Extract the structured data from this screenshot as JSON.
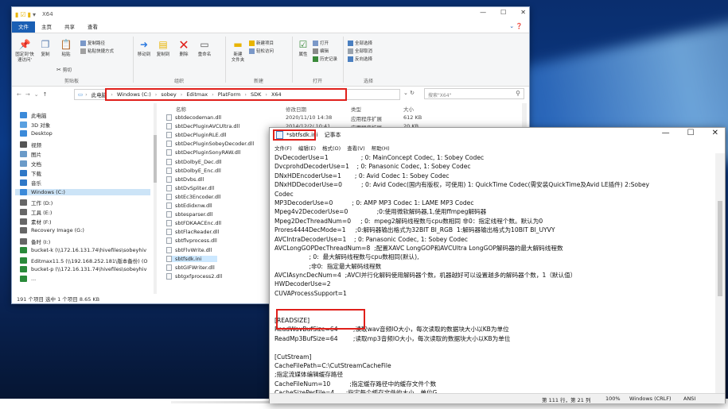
{
  "explorer": {
    "title": "X64",
    "tabs": [
      "文件",
      "主页",
      "共享",
      "查看"
    ],
    "ribbon": {
      "clipboard": {
        "pin": "固定到'快\n速访问'",
        "copy": "复制",
        "paste": "粘贴",
        "cut_path": "复制路径",
        "paste_shortcut": "粘贴快捷方式",
        "cut": "剪切",
        "label": "剪贴板"
      },
      "organize": {
        "move_to": "移动到",
        "copy_to": "复制到",
        "delete": "删除",
        "rename": "重命名",
        "label": "组织"
      },
      "new": {
        "new_folder": "新建\n文件夹",
        "new_item": "新建项目",
        "easy_access": "轻松访问",
        "label": "新建"
      },
      "open": {
        "properties": "属性",
        "open": "打开",
        "edit": "编辑",
        "history": "历史记录",
        "label": "打开"
      },
      "select": {
        "select_all": "全部选择",
        "select_none": "全部取消",
        "invert": "反向选择",
        "label": "选择"
      }
    },
    "address": {
      "segments": [
        "此电脑",
        "Windows (C:)",
        "sobey",
        "Editmax",
        "PlatForm",
        "SDK",
        "X64"
      ]
    },
    "search_placeholder": "搜索\"X64\"",
    "nav_items": [
      {
        "label": "此电脑",
        "color": "#3b8ad9"
      },
      {
        "label": "3D 对象",
        "color": "#5aa0e0"
      },
      {
        "label": "Desktop",
        "color": "#3b8ad9"
      },
      {
        "label": "视频",
        "color": "#555"
      },
      {
        "label": "图片",
        "color": "#6a9ac8"
      },
      {
        "label": "文档",
        "color": "#6a9ac8"
      },
      {
        "label": "下载",
        "color": "#2f78c7"
      },
      {
        "label": "音乐",
        "color": "#2f78c7"
      },
      {
        "label": "Windows (C:)",
        "color": "#3b8ad9"
      },
      {
        "label": "工作 (D:)",
        "color": "#666"
      },
      {
        "label": "工具 (E:)",
        "color": "#666"
      },
      {
        "label": "素材 (F:)",
        "color": "#666"
      },
      {
        "label": "Recovery Image (G:)",
        "color": "#666"
      },
      {
        "label": "备时 (I:)",
        "color": "#666"
      },
      {
        "label": "bucket-k (\\\\172.16.131.74\\hivefiles\\sobeyhiv",
        "color": "#2a8a3a"
      },
      {
        "label": "Editmax11.5 (\\\\192.168.252.181\\版本备份) (O",
        "color": "#2a8a3a"
      },
      {
        "label": "bucket-p (\\\\172.16.131.74\\hivefiles\\sobeyhiv",
        "color": "#2a8a3a"
      },
      {
        "label": "...",
        "color": "#2a8a3a"
      }
    ],
    "columns": [
      "名称",
      "修改日期",
      "类型",
      "大小"
    ],
    "files": [
      "sbtdecodeman.dll",
      "sbtDecPluginAVCUltra.dll",
      "sbtDecPluginRLE.dll",
      "sbtDecPluginSobeyDecoder.dll",
      "sbtDecPluginSonyRAW.dll",
      "sbtDolbyE_Dec.dll",
      "sbtDolbyE_Enc.dll",
      "sbtDvbs.dll",
      "sbtDvSpliter.dll",
      "sbtEc3Encoder.dll",
      "sbtEdidxnw.dll",
      "sbtesparser.dll",
      "sbtFDKAACEnc.dll",
      "sbtFlacReader.dll",
      "sbtflvprocess.dll",
      "sbtFlvWrite.dll",
      "sbtfsdk.ini",
      "sbtGIFWriter.dll",
      "sbtgxfprocess2.dll"
    ],
    "selected_file_index": 16,
    "first_row": {
      "date": "2020/11/10 14:38",
      "type": "应用程序扩展",
      "size": "612 KB"
    },
    "second_row": {
      "date": "2014/12/2/ 10:41",
      "type": "应用程序扩展",
      "size": "20 KB"
    },
    "status": "191 个项目    选中 1 个项目  8.65 KB"
  },
  "notepad": {
    "filename": "*sbtfsdk.ini",
    "app": "记事本",
    "menu": [
      "文件(F)",
      "编辑(E)",
      "格式(O)",
      "查看(V)",
      "帮助(H)"
    ],
    "lines": [
      "DvDecoderUse=1                 ; 0: MainConcept Codec, 1: Sobey Codec",
      "DvcprohdDecoderUse=1    ; 0: Panasonic Codec, 1: Sobey Codec",
      "DNxHDEncoderUse=1       ; 0: Avid Codec 1: Sobey Codec",
      "DNxHDDecoderUse=0          ; 0: Avid Codec(国内有版权，可使用) 1: QuickTime Codec(需安装QuickTime及Avid LE插件) 2:Sobey",
      "Codec",
      "MP3DecoderUse=0          ; 0: AMP MP3 Codec 1: LAME MP3 Codec",
      "Mpeg4v2DecoderUse=0               ;0:使用微软解码器,1,使用ffmpeg解码器",
      "Mpeg2DecThreadNum=0     ; 0:  mpeg2解码线程数与cpu数相同 非0：指定线程个数。默认为0",
      "Prores4444DecMode=1     ;0:解码器输出格式为32BIT BI_RGB  1:解码器输出格式为10BIT BI_UYVY",
      "AVCIntraDecoderUse=1    ; 0: Panasonic Codec, 1: Sobey Codec",
      "AVCLongGOPDecThreadNum=8  ;配置XAVC LongGOP和AVCUltra LongGOP解码器的最大解码线程数",
      "                  ; 0:  最大解码线程数与cpu数相同(默认),",
      "                  ;非0:  指定最大解码线程数",
      "AVCIAsyncDecNum=4  ;AVCI并行化解码使用解码器个数，机器越好可以设置越多的解码器个数，1（默认值）",
      "HWDecoderUse=2",
      "CUVAProcessSupport=1",
      "",
      "",
      "[READSIZE]",
      "ReadWavBufSize=64        ;读取wav音频IO大小，每次读取的数据块大小以KB为单位",
      "ReadMp3BufSize=64        ;读取mp3音频IO大小，每次读取的数据块大小以KB为单位",
      "",
      "[CutStream]",
      "CacheFilePath=C:\\CutStreamCacheFile",
      ";指定流媒体编辑缓存路径",
      "CacheFileNum=10          ;指定缓存路径中的缓存文件个数",
      "CacheSizePerFile=4      ;指定每个缓存文件的大小，单位G"
    ],
    "status": {
      "position": "第 111 行，第 21 列",
      "zoom": "100%",
      "eol": "Windows (CRLF)",
      "encoding": "ANSI"
    }
  }
}
